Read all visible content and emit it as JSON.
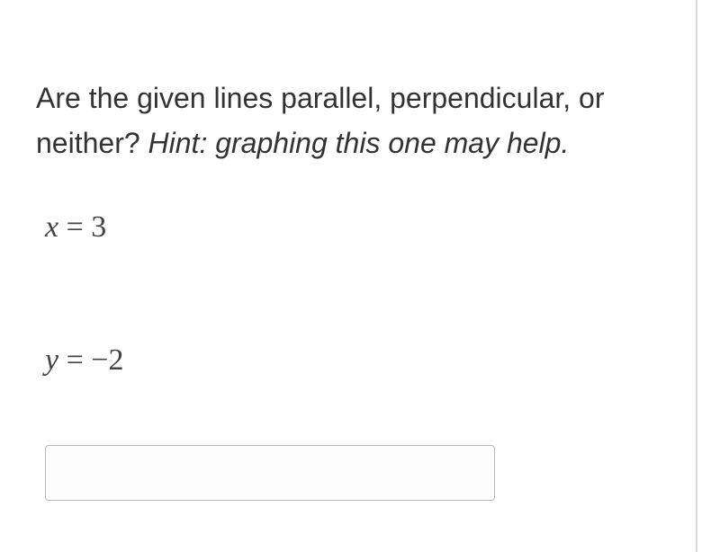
{
  "question": {
    "prompt_part1": "Are the given lines parallel, perpendicular, or neither? ",
    "hint": "Hint: graphing this one may help."
  },
  "equations": {
    "eq1_var": "x",
    "eq1_eq": " = ",
    "eq1_val": "3",
    "eq2_var": "y",
    "eq2_eq": " = ",
    "eq2_val": "−2"
  },
  "answer": {
    "value": ""
  }
}
